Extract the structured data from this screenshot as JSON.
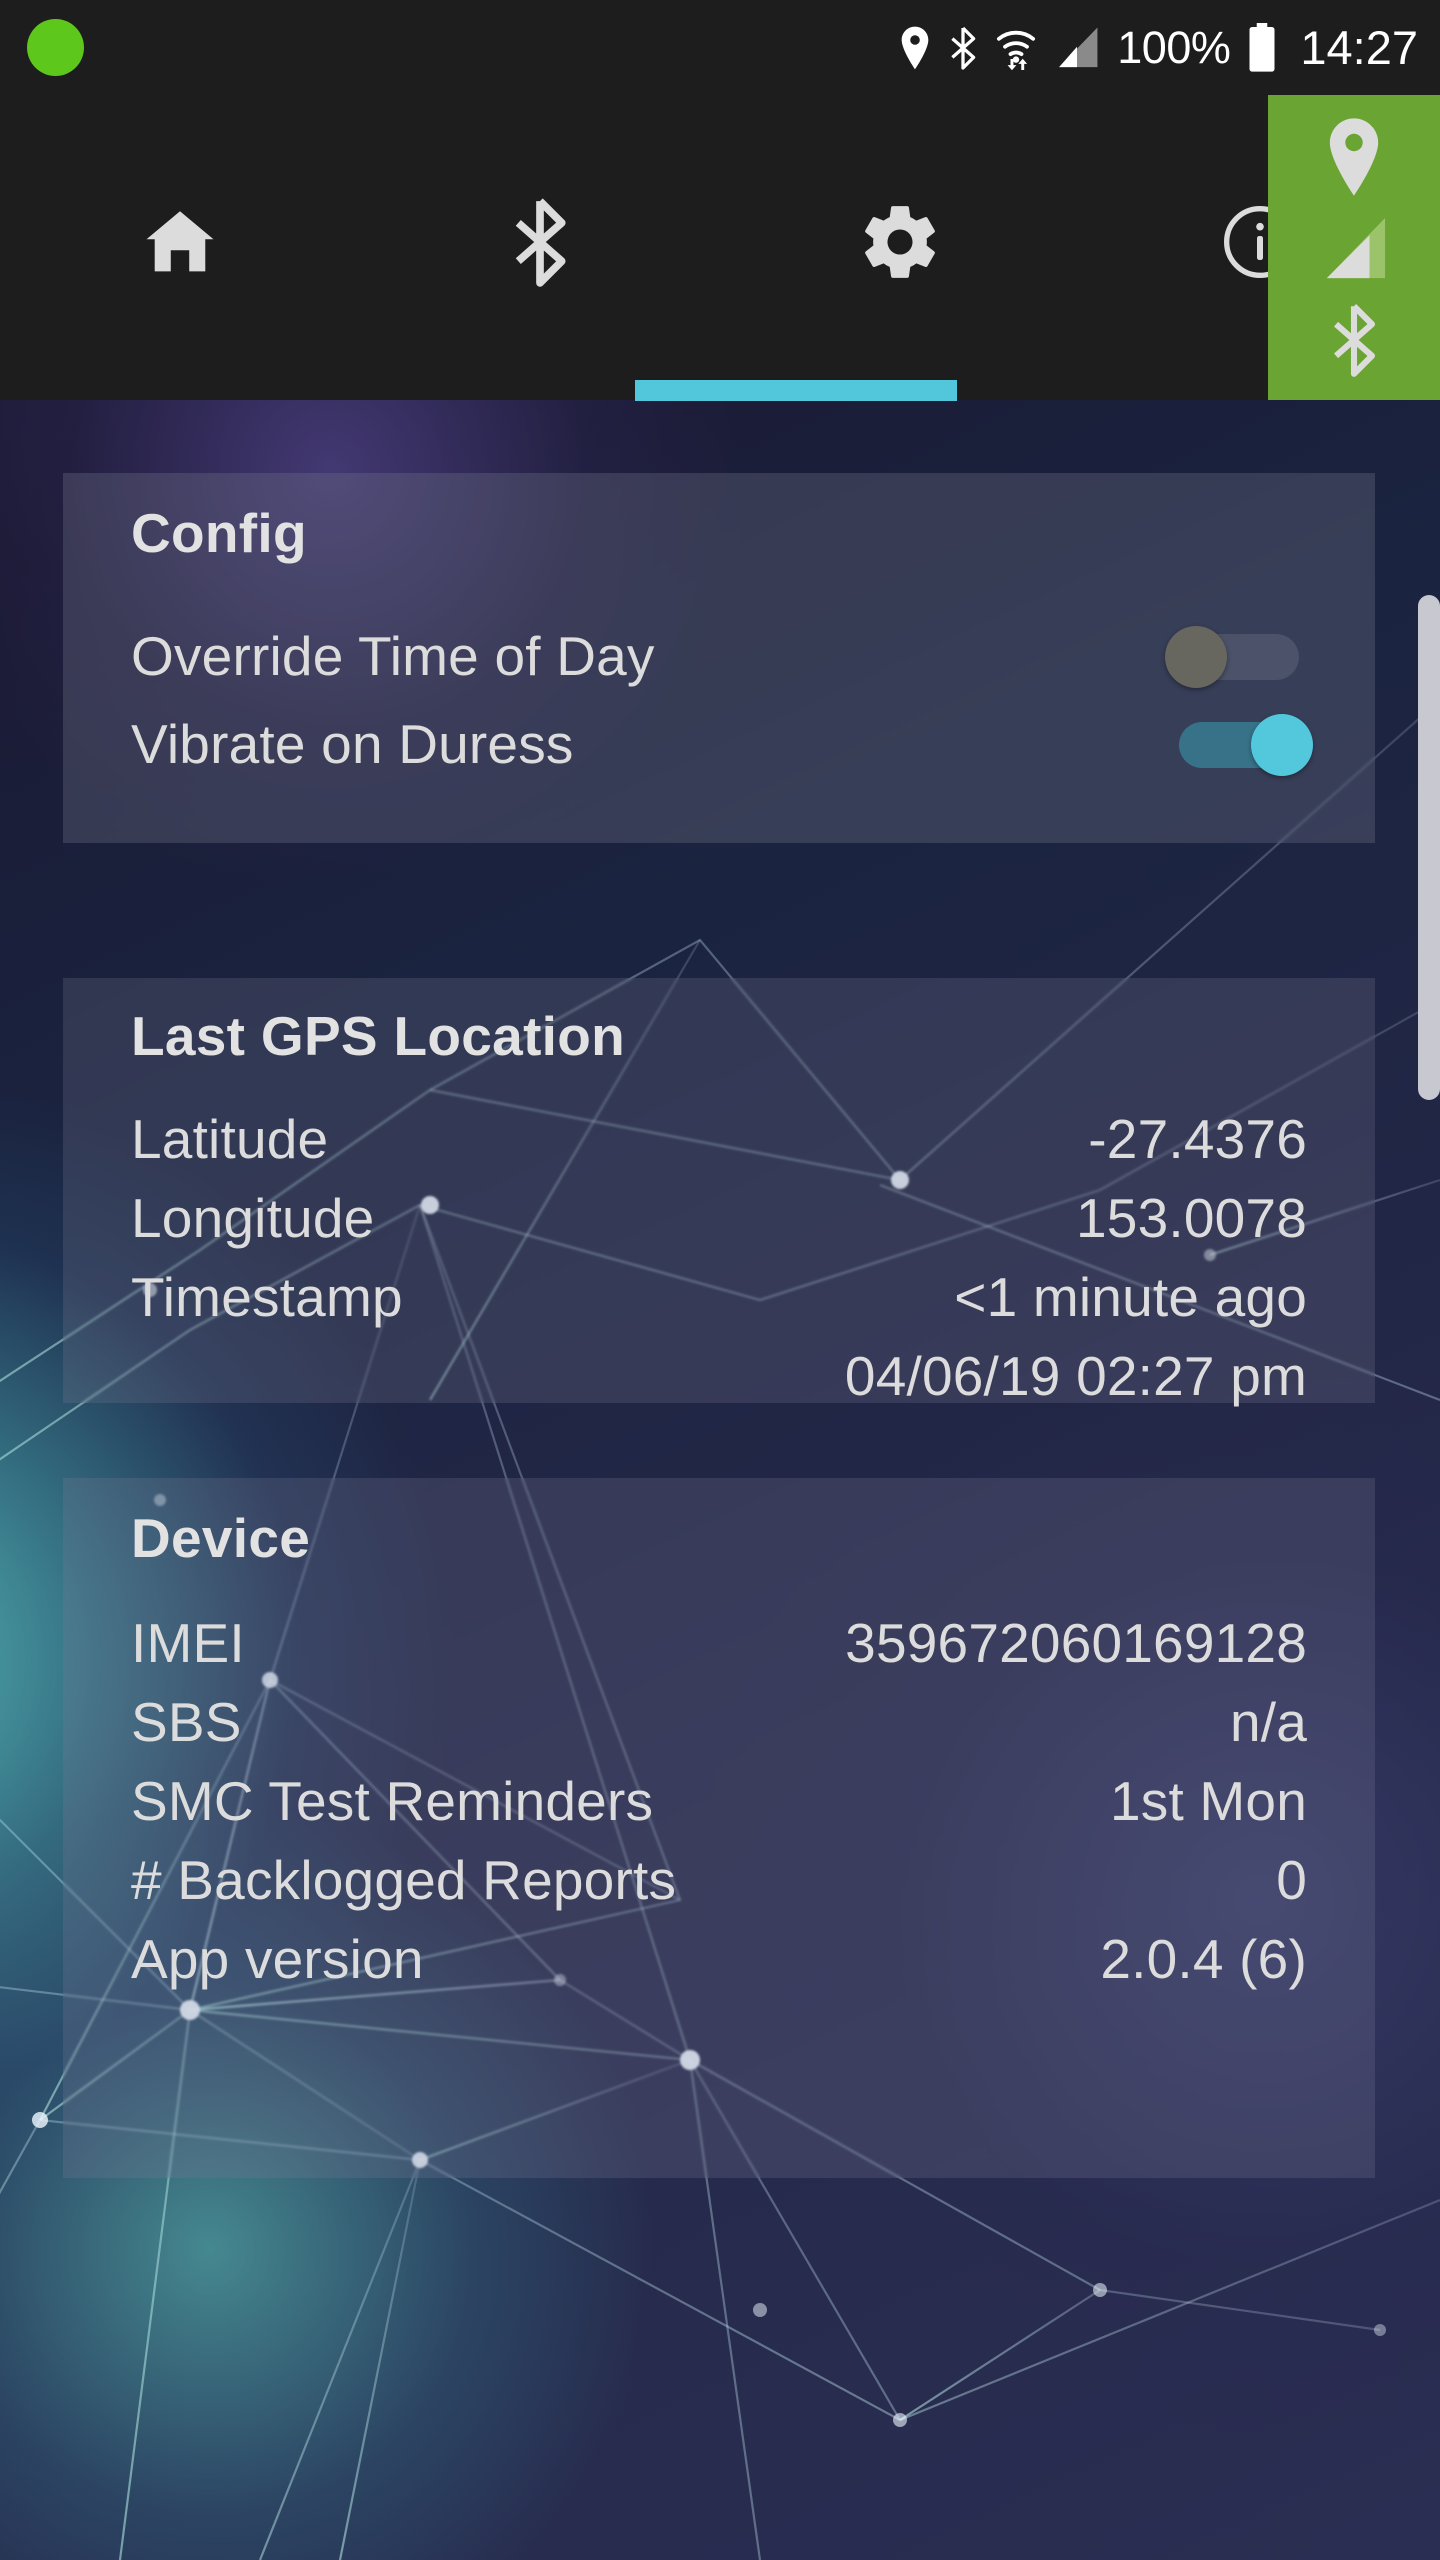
{
  "statusbar": {
    "indicator_dot": "green-recording-dot",
    "indicator_color": "#5ec71c",
    "icons": [
      "location-pin-icon",
      "bluetooth-icon",
      "wifi-icon",
      "cell-signal-icon"
    ],
    "battery_percent": "100%",
    "battery_icon": "battery-full-icon",
    "time": "14:27"
  },
  "tabbar": {
    "tabs": [
      {
        "name": "home",
        "icon": "home-icon",
        "selected": false
      },
      {
        "name": "bluetooth",
        "icon": "bluetooth-icon",
        "selected": false
      },
      {
        "name": "settings",
        "icon": "gear-icon",
        "selected": true
      },
      {
        "name": "info",
        "icon": "info-circle-icon",
        "selected": false
      }
    ],
    "indicator_color": "#52c6da",
    "background_color": "#1d1d1d"
  },
  "status_panel": {
    "background_color": "#6aa432",
    "icons": [
      "location-pin-icon",
      "cell-signal-icon",
      "bluetooth-icon"
    ],
    "signal_bars_filled": 3,
    "signal_bars_total": 4
  },
  "cards": {
    "config": {
      "title": "Config",
      "rows": [
        {
          "label": "Override Time of Day",
          "toggle": "off"
        },
        {
          "label": "Vibrate on Duress",
          "toggle": "on"
        }
      ],
      "toggle_on_color": "#53c8dd",
      "toggle_off_color": "#67665f"
    },
    "gps": {
      "title": "Last GPS Location",
      "rows": [
        {
          "label": "Latitude",
          "value": "-27.4376"
        },
        {
          "label": "Longitude",
          "value": "153.0078"
        },
        {
          "label": "Timestamp",
          "value": "<1 minute ago"
        },
        {
          "label": "",
          "value": "04/06/19 02:27 pm"
        }
      ]
    },
    "device": {
      "title": "Device",
      "rows": [
        {
          "label": "IMEI",
          "value": "359672060169128"
        },
        {
          "label": "SBS",
          "value": "n/a"
        },
        {
          "label": "SMC Test Reminders",
          "value": "1st Mon"
        },
        {
          "label": "# Backlogged Reports",
          "value": "0"
        },
        {
          "label": "App version",
          "value": "2.0.4 (6)"
        }
      ]
    }
  },
  "scrollbar": {
    "name": "vertical-scrollbar",
    "color": "#c8c8d0"
  }
}
